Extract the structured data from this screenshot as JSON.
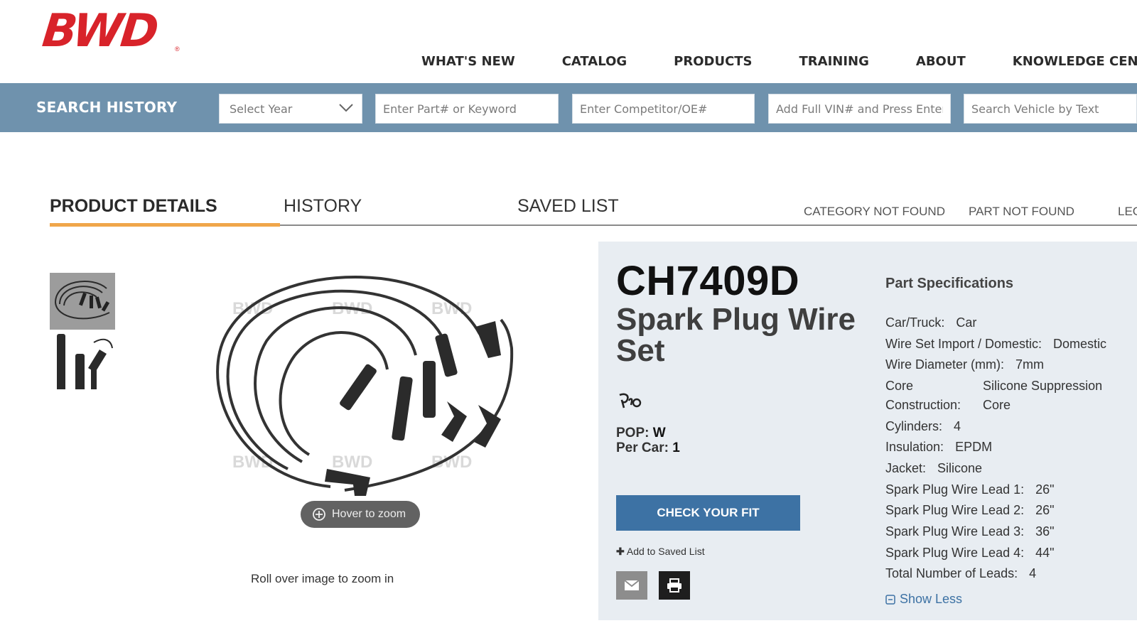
{
  "header": {
    "logo_text": "BWD",
    "logo_mark": "®",
    "brand_color": "#d8232a",
    "nav": [
      "WHAT'S NEW",
      "CATALOG",
      "PRODUCTS",
      "TRAINING",
      "ABOUT",
      "KNOWLEDGE CENTER"
    ]
  },
  "search": {
    "title": "SEARCH HISTORY",
    "bar_color": "#6f92ad",
    "year_selected": "Select Year",
    "part_placeholder": "Enter Part# or Keyword",
    "competitor_placeholder": "Enter Competitor/OE#",
    "vin_placeholder": "Add Full VIN# and Press Enter",
    "vehicle_placeholder": "Search Vehicle by Text"
  },
  "tabs": {
    "items": [
      "PRODUCT DETAILS",
      "HISTORY",
      "SAVED LIST"
    ],
    "active": "PRODUCT DETAILS",
    "links": [
      "CATEGORY NOT FOUND",
      "PART NOT FOUND",
      "LEG"
    ]
  },
  "gallery": {
    "watermark": "BWD",
    "zoom_label": "Hover to zoom",
    "zoom_note": "Roll over image to zoom in"
  },
  "product": {
    "part_number": "CH7409D",
    "name": "Spark Plug Wire Set",
    "badge_icon": "pro-icon",
    "pop_label": "POP:",
    "pop_value": "W",
    "per_car_label": "Per Car:",
    "per_car_value": "1",
    "check_fit_label": "CHECK YOUR FIT",
    "add_saved_label": "Add to Saved List",
    "email_icon": "email-icon",
    "print_icon": "print-icon",
    "accent_color": "#3d72a4"
  },
  "specs": {
    "title": "Part Specifications",
    "rows": [
      {
        "label": "Car/Truck:",
        "value": "Car"
      },
      {
        "label": "Wire Set Import / Domestic:",
        "value": "Domestic"
      },
      {
        "label": "Wire Diameter (mm):",
        "value": "7mm"
      },
      {
        "label": "Core",
        "value": "Silicone Suppression"
      },
      {
        "label": "Construction:",
        "value": "Core"
      },
      {
        "label": "Cylinders:",
        "value": "4"
      },
      {
        "label": "Insulation:",
        "value": "EPDM"
      },
      {
        "label": "Jacket:",
        "value": "Silicone"
      },
      {
        "label": "Spark Plug Wire Lead 1:",
        "value": "26\""
      },
      {
        "label": "Spark Plug Wire Lead 2:",
        "value": "26\""
      },
      {
        "label": "Spark Plug Wire Lead 3:",
        "value": "36\""
      },
      {
        "label": "Spark Plug Wire Lead 4:",
        "value": "44\""
      },
      {
        "label": "Total Number of Leads:",
        "value": "4"
      }
    ],
    "show_less_label": "Show Less"
  }
}
